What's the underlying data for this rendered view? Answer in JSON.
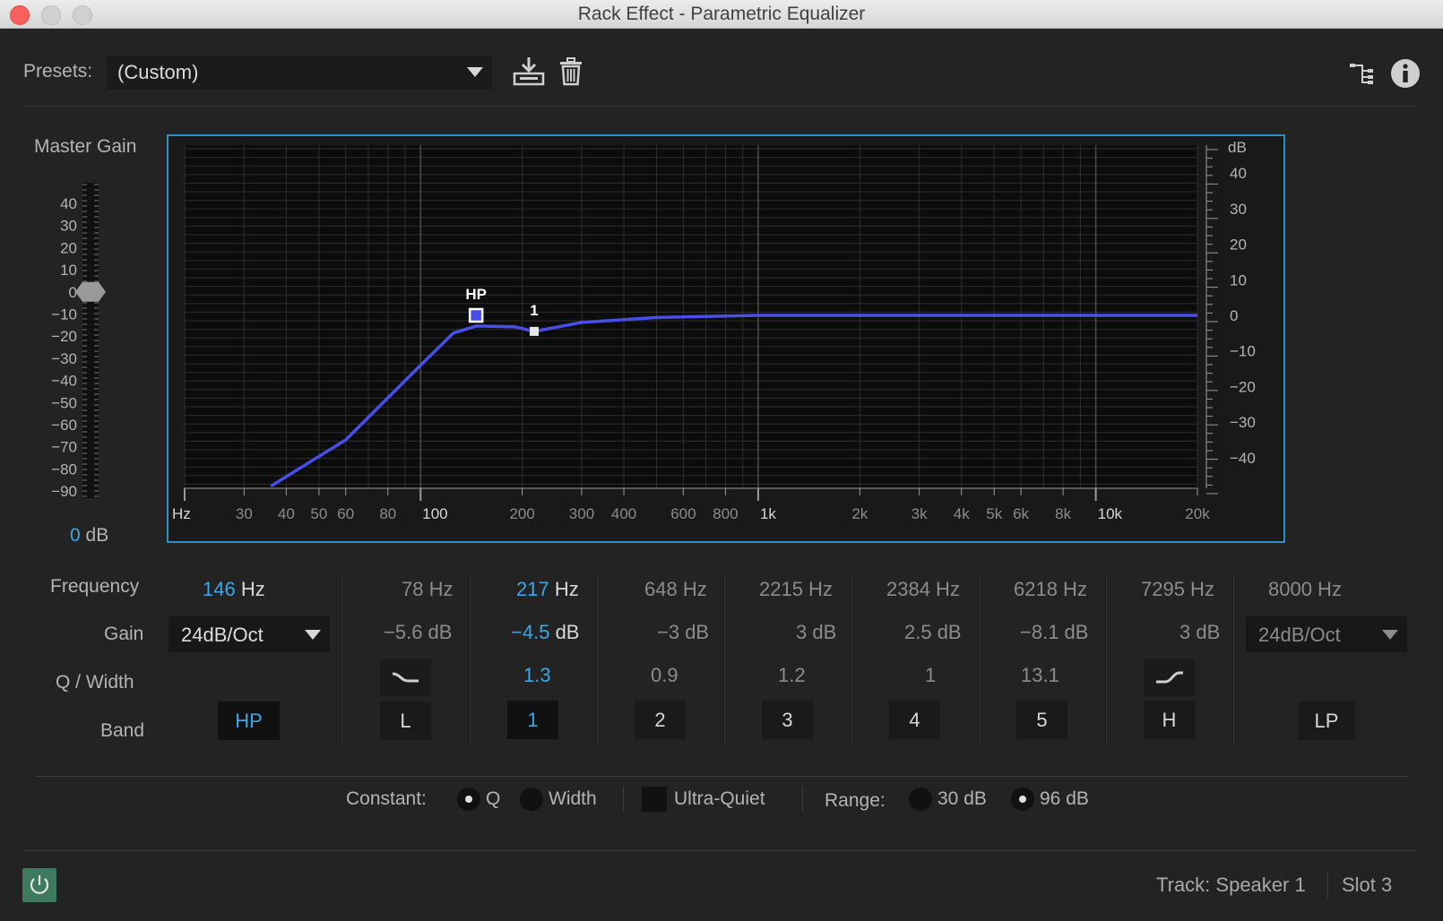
{
  "window": {
    "title": "Rack Effect - Parametric Equalizer"
  },
  "toolbar": {
    "presets_label": "Presets:",
    "preset_value": "(Custom)",
    "save_icon": "save-preset-icon",
    "delete_icon": "trash-icon",
    "routing_icon": "routing-icon",
    "info_icon": "info-icon"
  },
  "master_gain": {
    "label": "Master Gain",
    "value_number": "0",
    "value_unit": "dB",
    "scale": [
      "40",
      "30",
      "20",
      "10",
      "0",
      "−10",
      "−20",
      "−30",
      "−40",
      "−50",
      "−60",
      "−70",
      "−80",
      "−90"
    ],
    "value_db": 0
  },
  "graph": {
    "freq_ticks": [
      {
        "label": "Hz",
        "f": 20,
        "major": true
      },
      {
        "label": "30",
        "f": 30
      },
      {
        "label": "40",
        "f": 40
      },
      {
        "label": "50",
        "f": 50
      },
      {
        "label": "60",
        "f": 60
      },
      {
        "label": "80",
        "f": 80
      },
      {
        "label": "100",
        "f": 100,
        "major": true
      },
      {
        "label": "200",
        "f": 200
      },
      {
        "label": "300",
        "f": 300
      },
      {
        "label": "400",
        "f": 400
      },
      {
        "label": "600",
        "f": 600
      },
      {
        "label": "800",
        "f": 800
      },
      {
        "label": "1k",
        "f": 1000,
        "major": true
      },
      {
        "label": "2k",
        "f": 2000
      },
      {
        "label": "3k",
        "f": 3000
      },
      {
        "label": "4k",
        "f": 4000
      },
      {
        "label": "5k",
        "f": 5000
      },
      {
        "label": "6k",
        "f": 6000
      },
      {
        "label": "8k",
        "f": 8000
      },
      {
        "label": "10k",
        "f": 10000,
        "major": true
      },
      {
        "label": "20k",
        "f": 20000
      }
    ],
    "db_unit": "dB",
    "db_ticks": [
      "40",
      "30",
      "20",
      "10",
      "0",
      "−10",
      "−20",
      "−30",
      "−40"
    ],
    "db_values": [
      40,
      30,
      20,
      10,
      0,
      -10,
      -20,
      -30,
      -40
    ],
    "curve_color": "#4a4ee8",
    "curve": [
      [
        36,
        -48
      ],
      [
        60,
        -35
      ],
      [
        100,
        -14
      ],
      [
        125,
        -5
      ],
      [
        146,
        -3
      ],
      [
        190,
        -3.2
      ],
      [
        217,
        -4.5
      ],
      [
        300,
        -2
      ],
      [
        500,
        -0.6
      ],
      [
        800,
        -0.2
      ],
      [
        1000,
        0
      ],
      [
        20000,
        0
      ]
    ],
    "points": [
      {
        "label": "HP",
        "f": 146,
        "db": 0,
        "color": "#4a4ee8",
        "selected": true
      },
      {
        "label": "1",
        "f": 217,
        "db": -4.5,
        "color": "#e8e8e8",
        "selected": false
      }
    ]
  },
  "bands": {
    "row_labels": {
      "frequency": "Frequency",
      "gain": "Gain",
      "q": "Q / Width",
      "band": "Band"
    },
    "hp": {
      "freq_num": "146",
      "freq_unit": "Hz",
      "slope": "24dB/Oct",
      "button": "HP"
    },
    "low": {
      "freq": "78 Hz",
      "gain": "−5.6 dB",
      "button": "L"
    },
    "b1": {
      "freq_num": "217",
      "freq_unit": "Hz",
      "gain_num": "−4.5",
      "gain_unit": "dB",
      "q": "1.3",
      "button": "1"
    },
    "b2": {
      "freq": "648 Hz",
      "gain": "−3 dB",
      "q": "0.9",
      "button": "2"
    },
    "b3": {
      "freq": "2215 Hz",
      "gain": "3 dB",
      "q": "1.2",
      "button": "3"
    },
    "b4": {
      "freq": "2384 Hz",
      "gain": "2.5 dB",
      "q": "1",
      "button": "4"
    },
    "b5": {
      "freq": "6218 Hz",
      "gain": "−8.1 dB",
      "q": "13.1",
      "button": "5"
    },
    "high": {
      "freq": "7295 Hz",
      "gain": "3 dB",
      "button": "H"
    },
    "lp": {
      "freq": "8000 Hz",
      "slope": "24dB/Oct",
      "button": "LP"
    }
  },
  "options": {
    "constant_label": "Constant:",
    "q_label": "Q",
    "width_label": "Width",
    "ultra_quiet_label": "Ultra-Quiet",
    "range_label": "Range:",
    "range_30": "30 dB",
    "range_96": "96 dB"
  },
  "footer": {
    "track": "Track: Speaker 1",
    "slot": "Slot 3"
  }
}
